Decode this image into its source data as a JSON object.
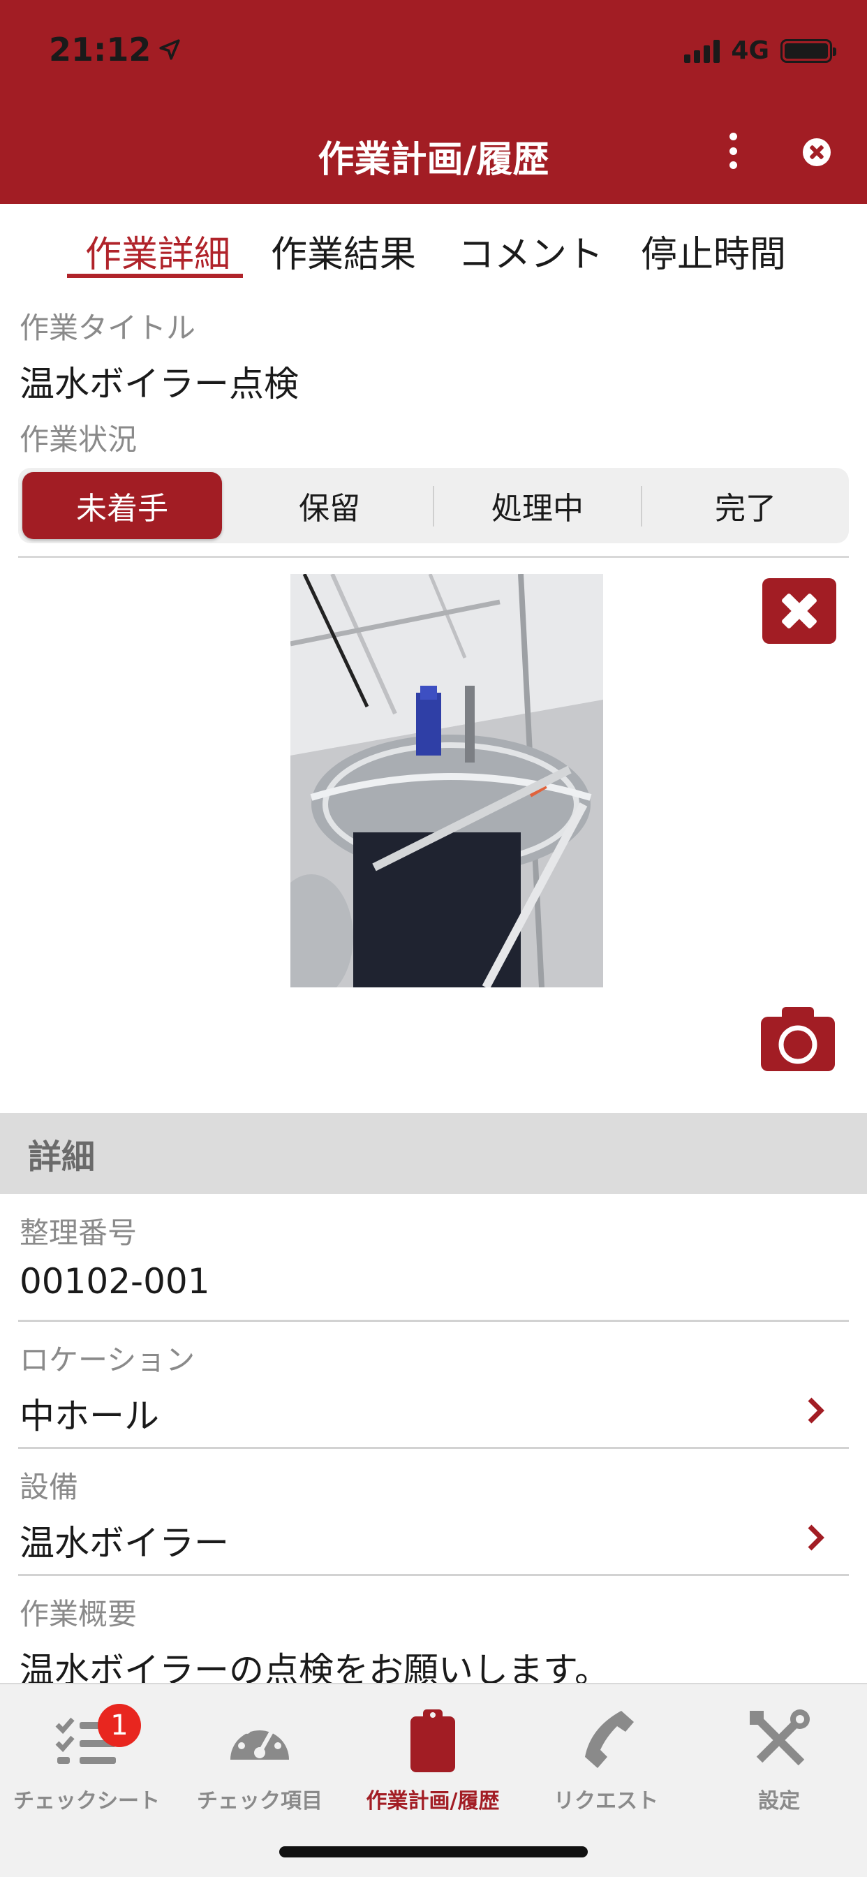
{
  "status_bar": {
    "time": "21:12",
    "network": "4G"
  },
  "header": {
    "title": "作業計画/履歴"
  },
  "tabs": [
    {
      "label": "作業詳細",
      "active": true
    },
    {
      "label": "作業結果",
      "active": false
    },
    {
      "label": "コメント",
      "active": false
    },
    {
      "label": "停止時間",
      "active": false
    }
  ],
  "work_title": {
    "label": "作業タイトル",
    "value": "温水ボイラー点検"
  },
  "work_status": {
    "label": "作業状況",
    "options": [
      "未着手",
      "保留",
      "処理中",
      "完了"
    ],
    "selected": "未着手"
  },
  "details": {
    "section_title": "詳細",
    "reference_number": {
      "label": "整理番号",
      "value": "00102-001"
    },
    "location": {
      "label": "ロケーション",
      "value": "中ホール"
    },
    "equipment": {
      "label": "設備",
      "value": "温水ボイラー"
    },
    "summary": {
      "label": "作業概要",
      "value": "温水ボイラーの点検をお願いします。"
    }
  },
  "bottom_nav": {
    "items": [
      {
        "label": "チェックシート",
        "icon": "checklist-icon",
        "badge": "1"
      },
      {
        "label": "チェック項目",
        "icon": "gauge-icon"
      },
      {
        "label": "作業計画/履歴",
        "icon": "clipboard-icon",
        "active": true
      },
      {
        "label": "リクエスト",
        "icon": "phone-icon"
      },
      {
        "label": "設定",
        "icon": "tools-icon"
      }
    ]
  },
  "colors": {
    "accent": "#a21d24",
    "badge": "#e8261f",
    "inactive": "#8a8a8a"
  }
}
